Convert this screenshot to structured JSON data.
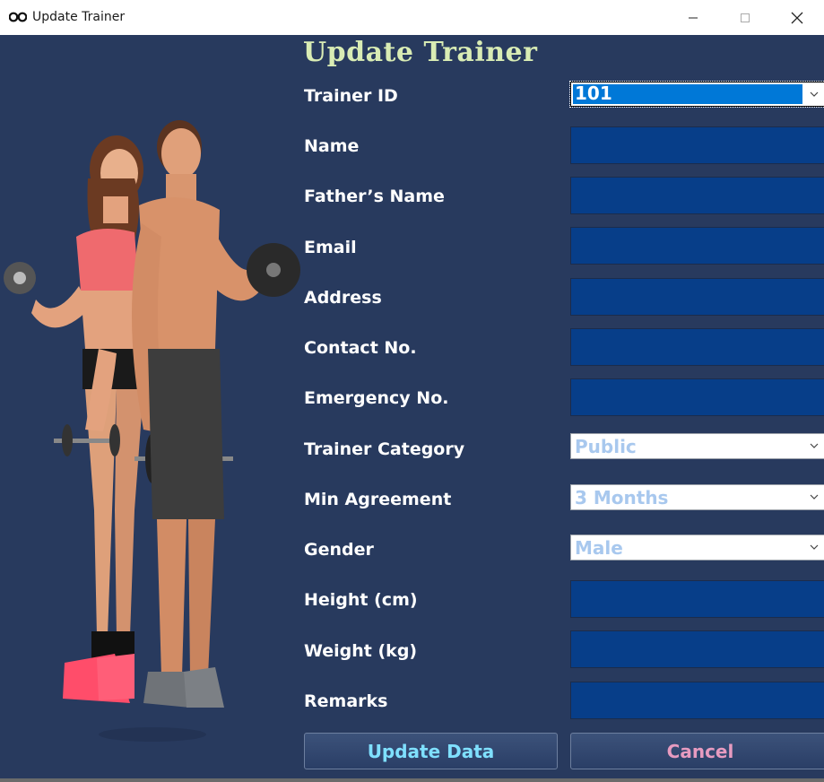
{
  "window": {
    "title": "Update Trainer"
  },
  "form": {
    "heading": "Update Trainer",
    "fields": [
      {
        "label": "Trainer ID",
        "type": "combo",
        "value": "101"
      },
      {
        "label": "Name",
        "type": "text",
        "value": ""
      },
      {
        "label": "Father’s Name",
        "type": "text",
        "value": ""
      },
      {
        "label": "Email",
        "type": "text",
        "value": ""
      },
      {
        "label": "Address",
        "type": "text",
        "value": ""
      },
      {
        "label": "Contact No.",
        "type": "text",
        "value": ""
      },
      {
        "label": "Emergency No.",
        "type": "text",
        "value": ""
      },
      {
        "label": "Trainer Category",
        "type": "combo",
        "value": "Public"
      },
      {
        "label": "Min Agreement",
        "type": "combo",
        "value": "3 Months"
      },
      {
        "label": "Gender",
        "type": "combo",
        "value": "Male"
      },
      {
        "label": "Height (cm)",
        "type": "text",
        "value": ""
      },
      {
        "label": "Weight (kg)",
        "type": "text",
        "value": ""
      },
      {
        "label": "Remarks",
        "type": "text",
        "value": ""
      }
    ]
  },
  "buttons": {
    "update": "Update Data",
    "cancel": "Cancel"
  },
  "colors": {
    "background": "#283a5e",
    "heading": "#d9ecb4",
    "field_fill": "#073e89",
    "selection": "#0078d7",
    "update_text": "#7fe0ff",
    "cancel_text": "#e79bc0"
  },
  "icons": {
    "app": "dumbbell-icon",
    "minimize": "minimize-icon",
    "maximize": "maximize-icon",
    "close": "close-icon",
    "dropdown": "chevron-down-icon"
  }
}
